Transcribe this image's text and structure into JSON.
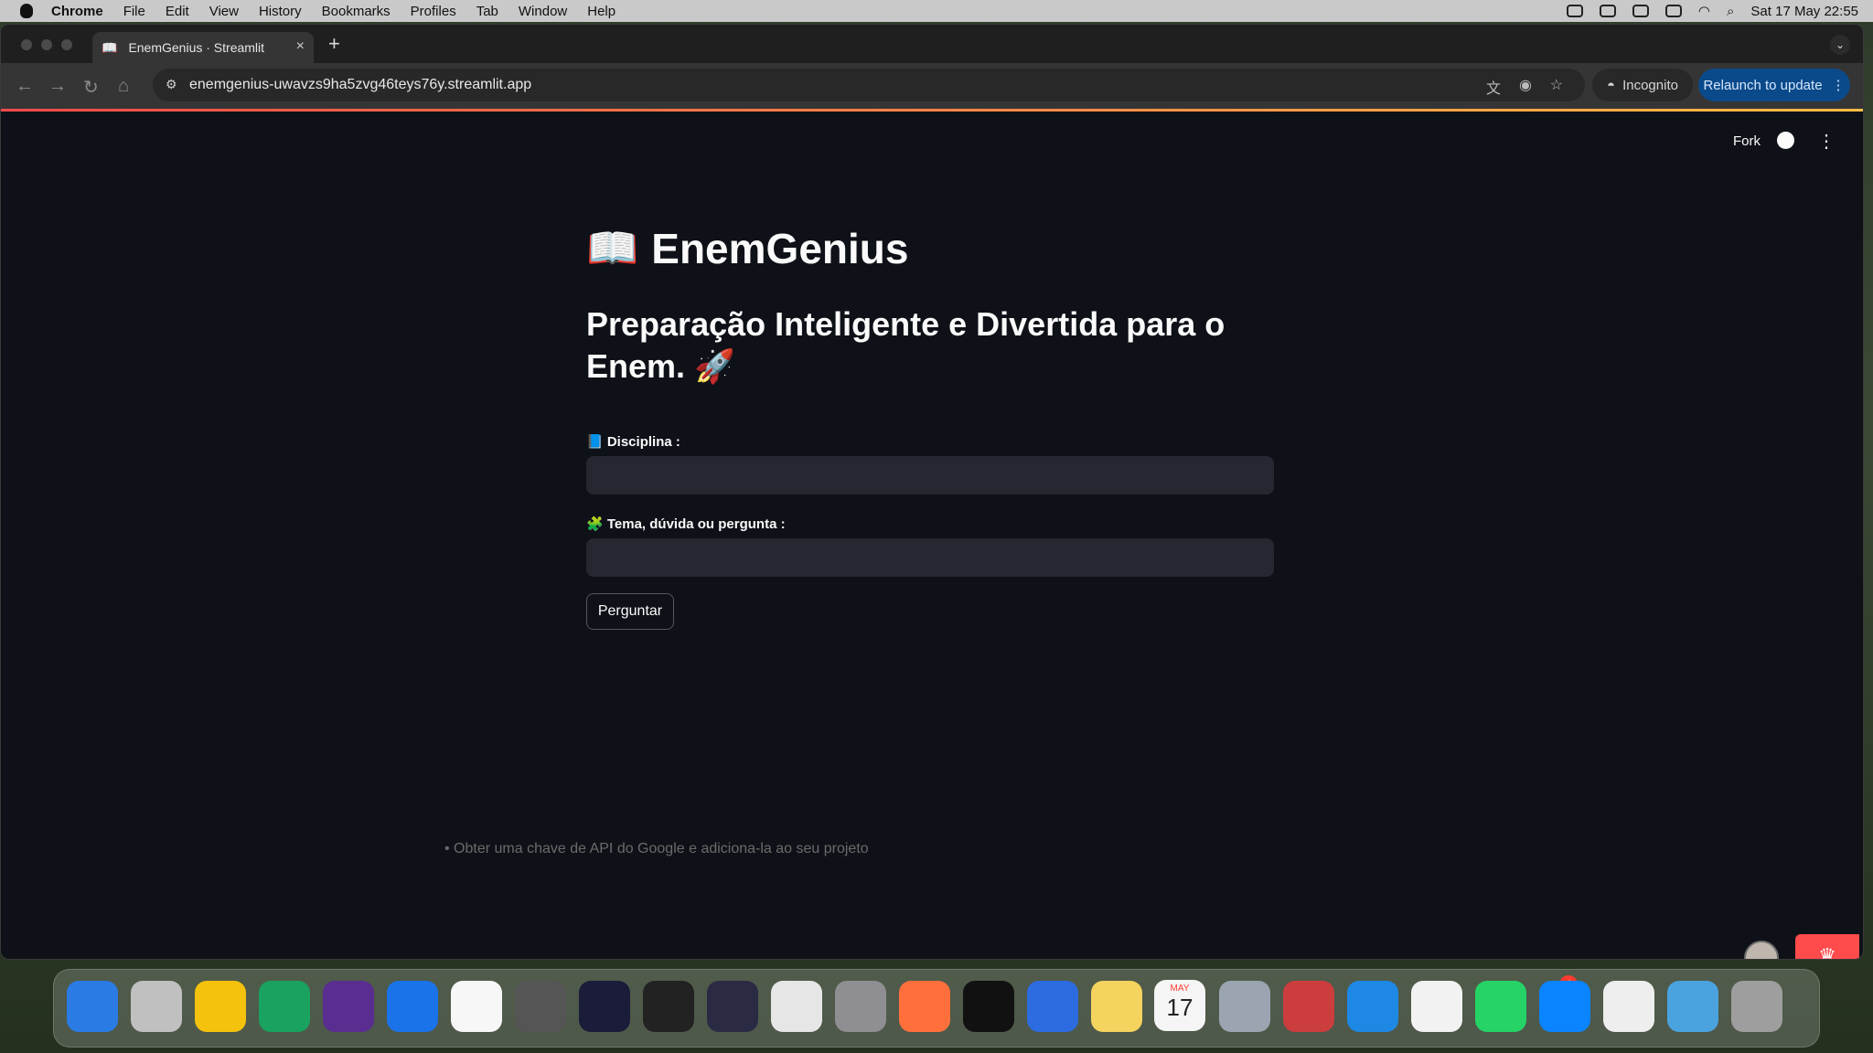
{
  "menubar": {
    "app_name": "Chrome",
    "menus": [
      "File",
      "Edit",
      "View",
      "History",
      "Bookmarks",
      "Profiles",
      "Tab",
      "Window",
      "Help"
    ],
    "clock": "Sat 17 May  22:55"
  },
  "browser": {
    "tab_title": "EnemGenius · Streamlit",
    "url": "enemgenius-uwavzs9ha5zvg46teys76y.streamlit.app",
    "incognito_label": "Incognito",
    "relaunch_label": "Relaunch to update"
  },
  "app": {
    "toolbar": {
      "fork_label": "Fork"
    },
    "title_icon": "📖",
    "title": "EnemGenius",
    "subtitle": "Preparação Inteligente e Divertida para o Enem. 🚀",
    "fields": [
      {
        "label": "📘 Disciplina :",
        "value": ""
      },
      {
        "label": "🧩 Tema, dúvida ou pergunta :",
        "value": ""
      }
    ],
    "ask_button": "Perguntar",
    "partial_text": "• Obter uma chave de API do Google e adiciona-la ao seu projeto"
  },
  "dock": {
    "calendar_month": "MAY",
    "calendar_day": "17",
    "whatsapp_badge": "4",
    "apps": [
      "finder",
      "launchpad",
      "chrome",
      "chat",
      "tor",
      "remote-desktop",
      "mongodb",
      "sequel",
      "intellij",
      "glasses",
      "tableplus",
      "postman",
      "system-settings",
      "paw",
      "terminal",
      "vpn",
      "notes",
      "calendar",
      "preview",
      "postgres",
      "vscode",
      "textedit",
      "whatsapp",
      "app-store",
      "enemgenius",
      "downloads",
      "trash"
    ],
    "colors": [
      "#2a7be4",
      "#c0c0c0",
      "#f4c20d",
      "#1aa260",
      "#5a2d91",
      "#1a73e8",
      "#f7f7f7",
      "#555555",
      "#1b1b3a",
      "#222222",
      "#2a2a44",
      "#e6e6e6",
      "#8e8e93",
      "#ff6f3c",
      "#111111",
      "#2d6be0",
      "#f4d35e",
      "#f5f5f5",
      "#9aa5b1",
      "#cc3d3d",
      "#1e88e5",
      "#f2f2f2",
      "#25d366",
      "#0a84ff",
      "#eeeeee",
      "#4aa3df",
      "#9e9e9e"
    ]
  }
}
